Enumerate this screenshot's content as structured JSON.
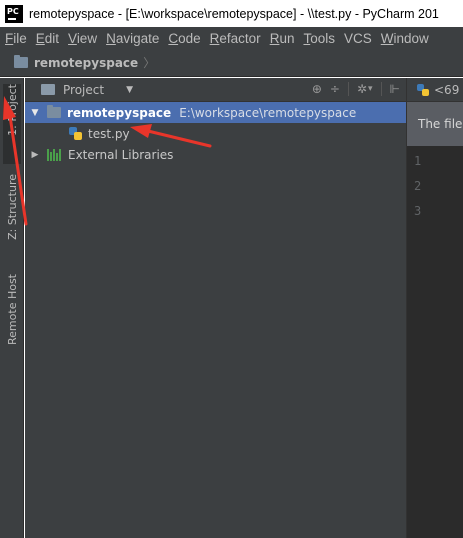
{
  "window": {
    "title": "remotepyspace - [E:\\workspace\\remotepyspace] - \\\\test.py - PyCharm 201",
    "logo_text": "PC"
  },
  "menu": [
    {
      "mnemonic": "F",
      "rest": "ile"
    },
    {
      "mnemonic": "E",
      "rest": "dit"
    },
    {
      "mnemonic": "V",
      "rest": "iew"
    },
    {
      "mnemonic": "N",
      "rest": "avigate"
    },
    {
      "mnemonic": "C",
      "rest": "ode"
    },
    {
      "mnemonic": "R",
      "rest": "efactor"
    },
    {
      "mnemonic": "R",
      "rest": "un"
    },
    {
      "mnemonic": "T",
      "rest": "ools"
    },
    {
      "mnemonic": "",
      "rest": "VCS"
    },
    {
      "mnemonic": "W",
      "rest": "indow"
    }
  ],
  "navbar": {
    "project_name": "remotepyspace",
    "chevron": "〉"
  },
  "tool_windows": {
    "project_tab": "1: Project",
    "structure_tab": "Z: Structure",
    "remote_host_tab": "Remote Host"
  },
  "project_panel": {
    "view_label": "Project",
    "caret": "▼",
    "tools": {
      "sync": "⊕",
      "collapse": "÷",
      "settings": "✲",
      "settings_caret": "▾",
      "hide": "⊩"
    },
    "tree": {
      "root": {
        "arrow": "▼",
        "label": "remotepyspace",
        "path": "E:\\workspace\\remotepyspace"
      },
      "file": {
        "label": "test.py"
      },
      "libraries": {
        "arrow": "▶",
        "label": "External Libraries"
      }
    }
  },
  "editor": {
    "tab_label": "<69",
    "notice": "The file",
    "line_numbers": [
      "1",
      "2",
      "3"
    ]
  },
  "colors": {
    "annotation_arrow": "#e8352a",
    "selection": "#4b6eaf",
    "panel_bg": "#3c3f41",
    "editor_bg": "#2b2b2b"
  }
}
